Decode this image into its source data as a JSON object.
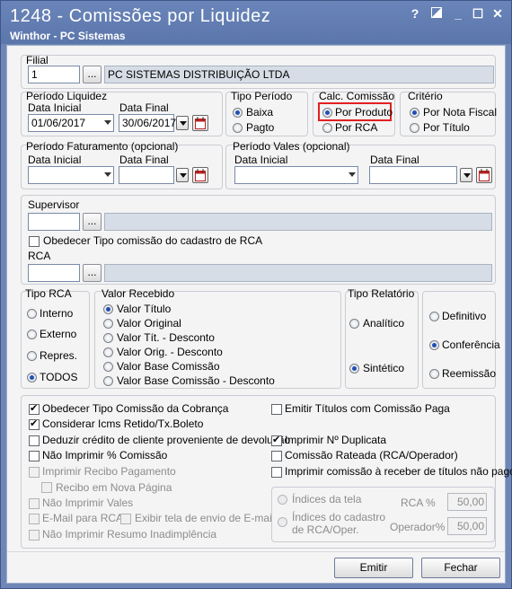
{
  "window": {
    "title": "1248 - Comissões por Liquidez",
    "subtitle": "Winthor - PC Sistemas",
    "help": "?",
    "minimize": "_",
    "maximize": "☐",
    "close": "✕"
  },
  "filial": {
    "group": "Filial",
    "code": "1",
    "name": "PC SISTEMAS DISTRIBUIÇÃO LTDA"
  },
  "periodo_liquidez": {
    "group": "Período Liquidez",
    "label_inicial": "Data Inicial",
    "label_final": "Data Final",
    "inicial": "01/06/2017",
    "final": "30/06/2017"
  },
  "tipo_periodo": {
    "group": "Tipo Período",
    "options": [
      "Baixa",
      "Pagto"
    ],
    "selected": "Baixa"
  },
  "calc_comissao": {
    "group": "Calc. Comissão",
    "options": [
      "Por Produto",
      "Por RCA"
    ],
    "selected": "Por Produto",
    "highlight_color": "#e32020"
  },
  "criterio": {
    "group": "Critério",
    "options": [
      "Por Nota Fiscal",
      "Por Título"
    ],
    "selected": "Por Nota Fiscal"
  },
  "periodo_faturamento": {
    "group": "Período Faturamento  (opcional)",
    "label_inicial": "Data Inicial",
    "label_final": "Data Final"
  },
  "periodo_vales": {
    "group": "Período Vales  (opcional)",
    "label_inicial": "Data Inicial",
    "label_final": "Data Final"
  },
  "supervisor": {
    "label": "Supervisor",
    "obedecer": "Obedecer Tipo comissão do cadastro de RCA",
    "rca_label": "RCA"
  },
  "tipo_rca": {
    "group": "Tipo RCA",
    "options": [
      "Interno",
      "Externo",
      "Repres.",
      "TODOS"
    ],
    "selected": "TODOS"
  },
  "valor_recebido": {
    "group": "Valor Recebido",
    "options": [
      "Valor Título",
      "Valor Original",
      "Valor Tít. - Desconto",
      "Valor Orig. - Desconto",
      "Valor Base Comissão",
      "Valor Base Comissão - Desconto"
    ],
    "selected": "Valor Título"
  },
  "tipo_relatorio": {
    "group": "Tipo Relatório",
    "options": [
      "Analítico",
      "Sintético"
    ],
    "selected": "Sintético"
  },
  "modo": {
    "options": [
      "Definitivo",
      "Conferência",
      "Reemissão"
    ],
    "selected": "Conferência"
  },
  "checks_left": [
    {
      "label": "Obedecer Tipo Comissão da Cobrança",
      "checked": true,
      "disabled": false
    },
    {
      "label": "Considerar Icms Retido/Tx.Boleto",
      "checked": true,
      "disabled": false
    },
    {
      "label": "Deduzir crédito de cliente proveniente de devolução",
      "checked": false,
      "disabled": false
    },
    {
      "label": "Não Imprimir % Comissão",
      "checked": false,
      "disabled": false
    },
    {
      "label": "Imprimir Recibo Pagamento",
      "checked": false,
      "disabled": true
    },
    {
      "label": "Recibo em Nova Página",
      "checked": false,
      "disabled": true
    },
    {
      "label": "Não Imprimir Vales",
      "checked": false,
      "disabled": true
    },
    {
      "label": "E-Mail para RCA",
      "checked": false,
      "disabled": true
    },
    {
      "label": "Exibir tela de envio de E-mail",
      "checked": false,
      "disabled": true
    },
    {
      "label": "Não Imprimir Resumo Inadimplência",
      "checked": false,
      "disabled": true
    }
  ],
  "checks_right": [
    {
      "label": "Emitir Títulos com Comissão Paga",
      "checked": false
    },
    {
      "label": "Imprimir Nº Duplicata",
      "checked": true
    },
    {
      "label": "Comissão Rateada (RCA/Operador)",
      "checked": false
    },
    {
      "label": "Imprimir comissão à receber de títulos não pagos",
      "checked": false
    }
  ],
  "indices": {
    "options": [
      "Índices da tela",
      "Índices do cadastro",
      "de RCA/Oper."
    ],
    "rca_label": "RCA %",
    "rca_value": "50,00",
    "oper_label": "Operador%",
    "oper_value": "50,00"
  },
  "buttons": {
    "emitir": "Emitir",
    "fechar": "Fechar",
    "browse": "..."
  }
}
